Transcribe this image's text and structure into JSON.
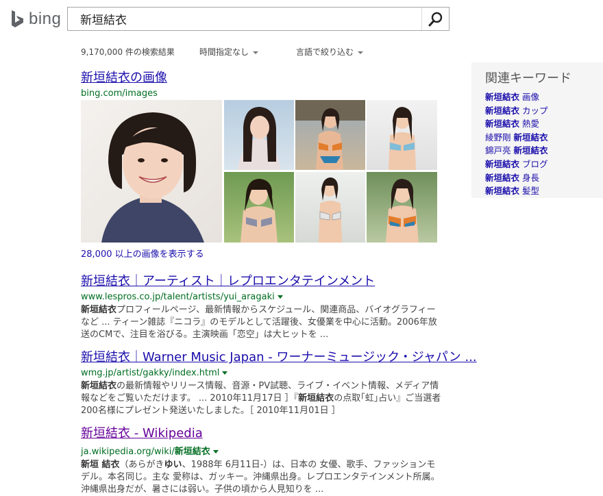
{
  "brand": {
    "logo_text": "bing",
    "logo_icon": "bing-b-icon"
  },
  "search": {
    "query": "新垣結衣",
    "button_icon": "search-icon"
  },
  "filters": {
    "result_count": "9,170,000 件の検索結果",
    "time_filter": "時間指定なし",
    "language_filter": "言語で絞り込む"
  },
  "images_result": {
    "title": "新垣結衣の画像",
    "url": "bing.com/images",
    "more_link": "28,000 以上の画像を表示する"
  },
  "results": [
    {
      "title": "新垣結衣｜アーティスト｜レプロエンタテインメント",
      "url": "www.lespros.co.jp/talent/artists/yui_aragaki",
      "snippet_bold": "新垣結衣",
      "snippet_rest": "プロフィールページ、最新情報からスケジュール、関連商品、バイオグラフィーなど ... ティーン雑誌『ニコラ』のモデルとして活躍後、女優業を中心に活動。2006年放送のCMで、注目を浴びる。主演映画「恋空」は大ヒットを ..."
    },
    {
      "title": "新垣結衣｜Warner Music Japan - ワーナーミュージック・ジャパン ...",
      "url": "wmg.jp/artist/gakky/index.html",
      "snippet_bold": "新垣結衣",
      "snippet_rest": "の最新情報やリリース情報、音源・PV試聴、ライブ・イベント情報、メディア情報などをご覧いただけます。 ... 2010年11月17日 ］『",
      "snippet_bold2": "新垣結衣",
      "snippet_rest2": "の点取｢虹｣占い』ご当選者200名様にプレゼント発送いたしました。［ 2010年11月01日 ］"
    },
    {
      "title": "新垣結衣 - Wikipedia",
      "url": "ja.wikipedia.org/wiki/",
      "url_bold": "新垣結衣",
      "snippet_bold": "新垣 結衣",
      "snippet_mid": "（あらがき",
      "snippet_bold2": "ゆい",
      "snippet_rest": "、1988年 6月11日-）は、日本の 女優、歌手、ファッションモデル。本名同じ。主な 愛称は、ガッキー。沖縄県出身。レプロエンタテインメント所属。沖縄県出身だが、暑さには弱い。子供の頃から人見知りを ..."
    }
  ],
  "related": {
    "title": "関連キーワード",
    "items": [
      {
        "bold": "新垣結衣",
        "rest": " 画像",
        "bold_first": true
      },
      {
        "bold": "新垣結衣",
        "rest": " カップ",
        "bold_first": true
      },
      {
        "bold": "新垣結衣",
        "rest": " 熱愛",
        "bold_first": true
      },
      {
        "pre": "綾野剛 ",
        "bold": "新垣結衣",
        "bold_first": false
      },
      {
        "pre": "錦戸亮 ",
        "bold": "新垣結衣",
        "bold_first": false
      },
      {
        "bold": "新垣結衣",
        "rest": " ブログ",
        "bold_first": true
      },
      {
        "bold": "新垣結衣",
        "rest": " 身長",
        "bold_first": true
      },
      {
        "bold": "新垣結衣",
        "rest": " 髪型",
        "bold_first": true
      }
    ]
  },
  "colors": {
    "link": "#1a0dab",
    "visited": "#660099",
    "url_green": "#006d21",
    "sidebar_bg": "#f5f5f5"
  }
}
